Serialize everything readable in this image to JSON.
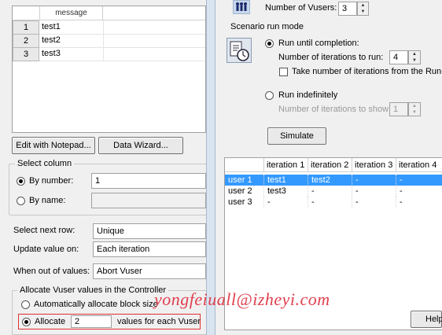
{
  "data_grid": {
    "column_header": "message",
    "rows": [
      {
        "num": "1",
        "value": "test1"
      },
      {
        "num": "2",
        "value": "test2"
      },
      {
        "num": "3",
        "value": "test3"
      }
    ]
  },
  "buttons": {
    "edit_notepad": "Edit with Notepad...",
    "data_wizard": "Data Wizard...",
    "simulate": "Simulate",
    "help": "Help"
  },
  "select_column": {
    "title": "Select column",
    "by_number_label": "By number:",
    "by_number_value": "1",
    "by_name_label": "By name:"
  },
  "options": {
    "select_next_row_label": "Select next row:",
    "select_next_row_value": "Unique",
    "update_value_label": "Update value on:",
    "update_value_value": "Each iteration",
    "out_of_values_label": "When out of values:",
    "out_of_values_value": "Abort Vuser"
  },
  "allocate": {
    "title": "Allocate Vuser values in the Controller",
    "auto_label": "Automatically allocate block size",
    "allocate_label": "Allocate",
    "allocate_value": "2",
    "suffix": "values for each Vuser"
  },
  "right": {
    "vusers_label": "Number of Vusers:",
    "vusers_value": "3",
    "scenario_title": "Scenario run mode",
    "run_completion_label": "Run until completion:",
    "iterations_label": "Number of iterations to run:",
    "iterations_value": "4",
    "take_iterations_label": "Take number of iterations from the Run-T",
    "run_indefinitely_label": "Run indefinitely",
    "iterations_show_label": "Number of iterations to show:",
    "iterations_show_value": "1"
  },
  "results_table": {
    "headers": [
      "",
      "iteration 1",
      "iteration 2",
      "iteration 3",
      "iteration 4"
    ],
    "rows": [
      [
        "user 1",
        "test1",
        "test2",
        "-",
        "-"
      ],
      [
        "user 2",
        "test3",
        "-",
        "-",
        "-"
      ],
      [
        "user 3",
        "-",
        "-",
        "-",
        "-"
      ]
    ]
  },
  "watermark": "yongfeiuall@izheyi.com",
  "colors": {
    "selection": "#3399ff",
    "watermark": "#e0404e",
    "highlight_box": "#e03030"
  }
}
